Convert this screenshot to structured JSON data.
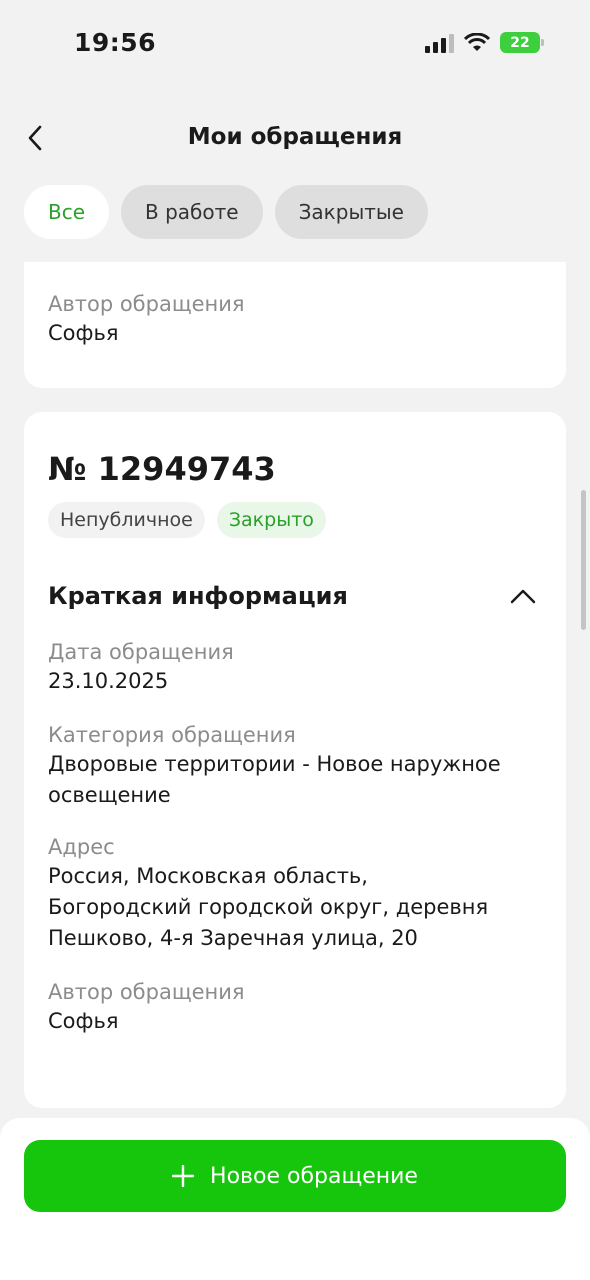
{
  "status_bar": {
    "time": "19:56",
    "battery": "22"
  },
  "header": {
    "title": "Мои обращения"
  },
  "tabs": [
    {
      "label": "Все",
      "active": true
    },
    {
      "label": "В работе",
      "active": false
    },
    {
      "label": "Закрытые",
      "active": false
    }
  ],
  "card_previous": {
    "author_label": "Автор обращения",
    "author_value": "Софья"
  },
  "card": {
    "number": "№ 12949743",
    "chips": [
      "Непубличное",
      "Закрыто"
    ],
    "section_title": "Краткая информация",
    "date_label": "Дата обращения",
    "date_value": "23.10.2025",
    "category_label": "Категория обращения",
    "category_value_line1": "Дворовые территории - Новое наружное",
    "category_value_line2": "освещение",
    "address_label": "Адрес",
    "address_line1": "Россия, Московская область,",
    "address_line2": "Богородский городской округ, деревня",
    "address_line3": "Пешково, 4-я Заречная улица, 20",
    "author_label": "Автор обращения",
    "author_value": "Софья"
  },
  "new_button": {
    "label": "Новое обращение"
  },
  "colors": {
    "accent": "#16c60c",
    "accent_text": "#2aa12a"
  },
  "icons": [
    "back-icon",
    "chevron-up-icon",
    "plus-icon",
    "signal-icon",
    "wifi-icon",
    "battery-icon"
  ]
}
